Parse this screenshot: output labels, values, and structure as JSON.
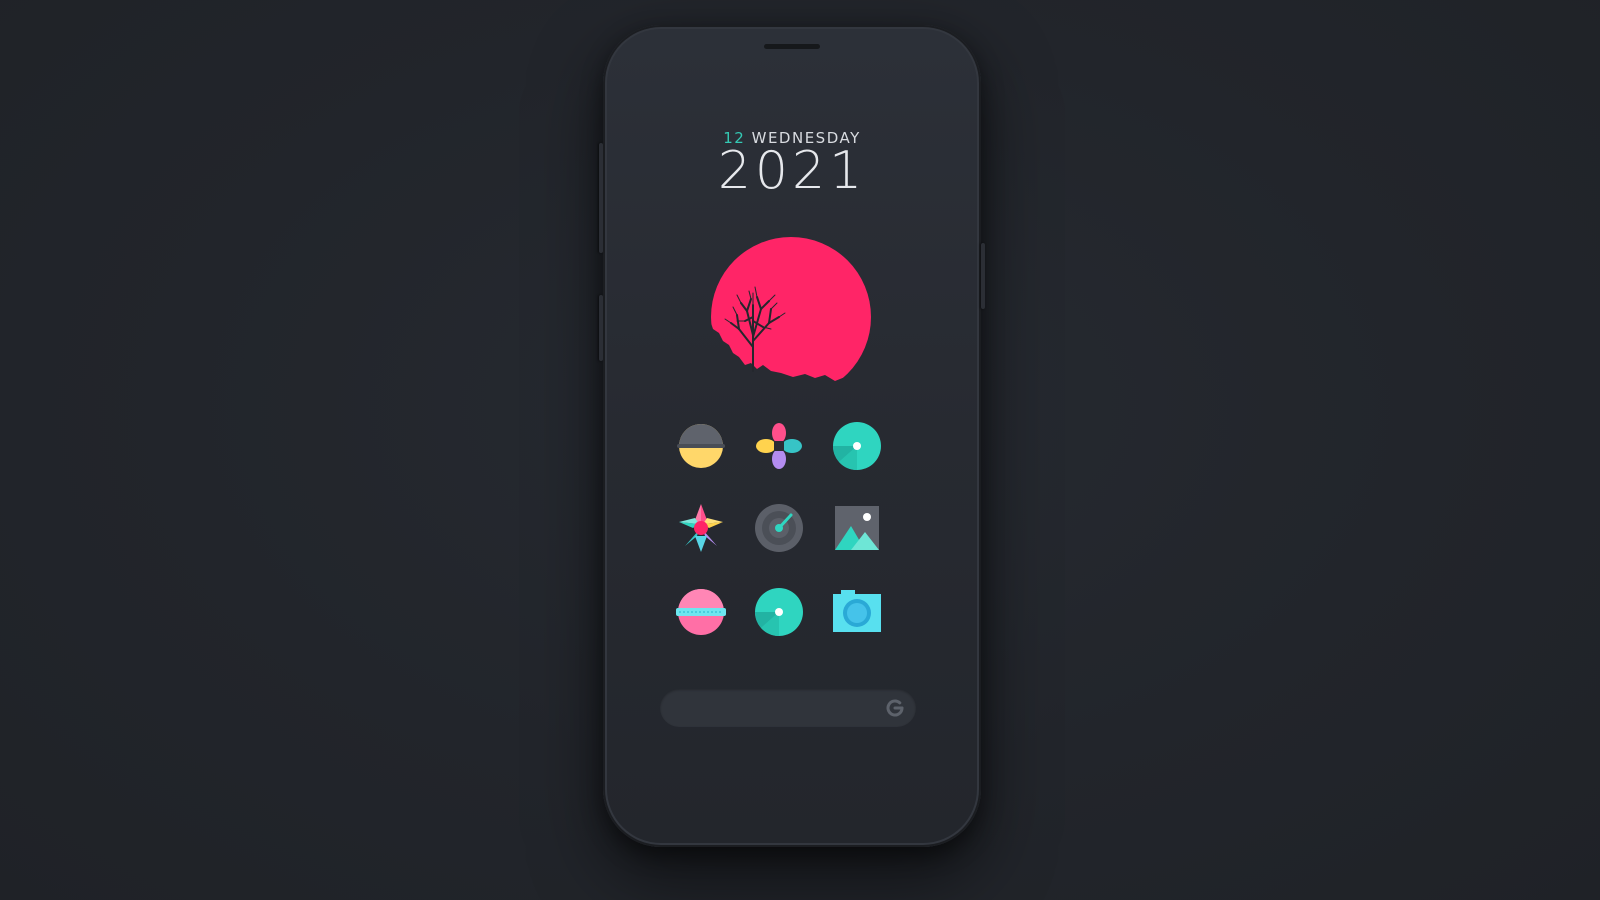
{
  "screen": {
    "date": {
      "day": "12",
      "weekday": "WEDNESDAY",
      "year": "2021"
    },
    "widget": {
      "icon": "red-sun-tree-icon",
      "color": "#ff2567"
    },
    "apps": [
      {
        "icon": "helmet-icon"
      },
      {
        "icon": "pinwheel-icon"
      },
      {
        "icon": "music-disc-icon"
      },
      {
        "icon": "photos-flower-icon"
      },
      {
        "icon": "radar-icon"
      },
      {
        "icon": "gallery-icon"
      },
      {
        "icon": "globe-icon"
      },
      {
        "icon": "disc-icon"
      },
      {
        "icon": "camera-icon"
      }
    ],
    "search": {
      "placeholder": "",
      "icon": "google-g-icon"
    },
    "colors": {
      "accent": "#34c9b4",
      "pink": "#ff2567",
      "background": "#22252b",
      "phone": "#2a2d34"
    }
  }
}
